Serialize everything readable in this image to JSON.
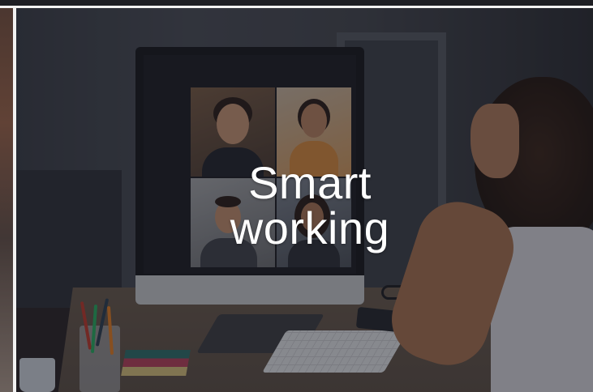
{
  "card": {
    "title_line1": "Smart",
    "title_line2": "working"
  },
  "image": {
    "subject": "person-on-video-call"
  },
  "colors": {
    "overlay": "#14161e",
    "caption": "#ffffff",
    "page_background": "#f2f2f2"
  }
}
